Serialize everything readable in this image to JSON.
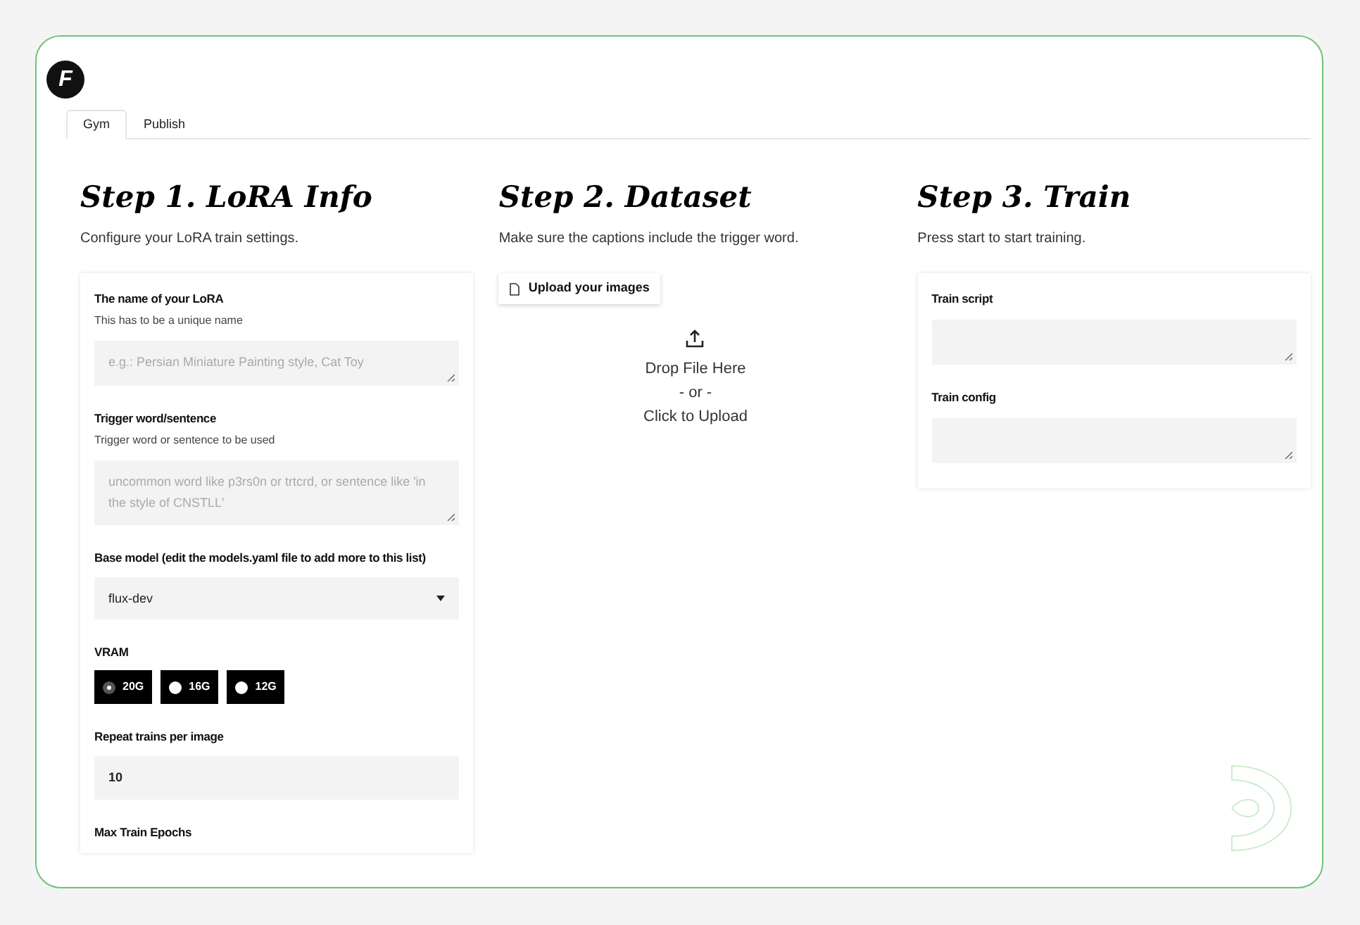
{
  "logo": {
    "letter": "F"
  },
  "tabs": [
    {
      "label": "Gym",
      "selected": true
    },
    {
      "label": "Publish",
      "selected": false
    }
  ],
  "step1": {
    "title": "Step 1. LoRA Info",
    "description": "Configure your LoRA train settings.",
    "fields": [
      {
        "kind": "textarea",
        "label": "The name of your LoRA",
        "hint": "This has to be a unique name",
        "placeholder": "e.g.: Persian Miniature Painting style, Cat Toy"
      },
      {
        "kind": "textarea",
        "label": "Trigger word/sentence",
        "hint": "Trigger word or sentence to be used",
        "placeholder": "uncommon word like p3rs0n or trtcrd, or sentence like 'in the style of CNSTLL'"
      },
      {
        "kind": "select",
        "label": "Base model (edit the models.yaml file to add more to this list)",
        "value": "flux-dev"
      },
      {
        "kind": "radio",
        "label": "VRAM",
        "options": [
          {
            "label": "20G",
            "selected": true
          },
          {
            "label": "16G",
            "selected": false
          },
          {
            "label": "12G",
            "selected": false
          }
        ]
      },
      {
        "kind": "number",
        "label": "Repeat trains per image",
        "value": "10"
      },
      {
        "kind": "heading",
        "label": "Max Train Epochs"
      }
    ]
  },
  "step2": {
    "title": "Step 2. Dataset",
    "description": "Make sure the captions include the trigger word.",
    "upload_button": "Upload your images",
    "dropzone": [
      "Drop File Here",
      "- or -",
      "Click to Upload"
    ]
  },
  "step3": {
    "title": "Step 3. Train",
    "description": "Press start to start training.",
    "fields": [
      {
        "kind": "textarea",
        "label": "Train script"
      },
      {
        "kind": "textarea",
        "label": "Train config"
      }
    ]
  }
}
